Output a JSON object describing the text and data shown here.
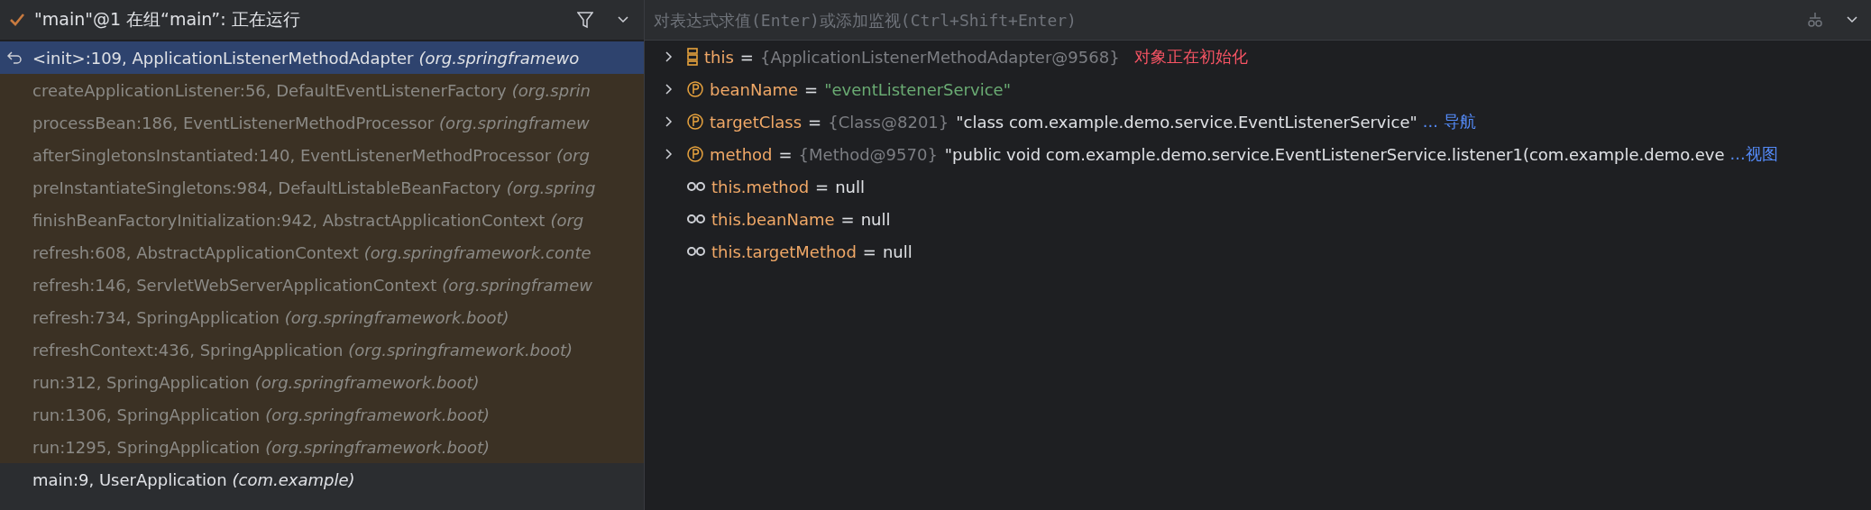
{
  "thread": {
    "check": true,
    "label": "\"main\"@1 在组“main”: 正在运行"
  },
  "frames": [
    {
      "method": "<init>:109, ApplicationListenerMethodAdapter",
      "package": "(org.springframewo",
      "selected": true,
      "library": false
    },
    {
      "method": "createApplicationListener:56, DefaultEventListenerFactory",
      "package": "(org.sprin",
      "selected": false,
      "library": true
    },
    {
      "method": "processBean:186, EventListenerMethodProcessor",
      "package": "(org.springframew",
      "selected": false,
      "library": true
    },
    {
      "method": "afterSingletonsInstantiated:140, EventListenerMethodProcessor",
      "package": "(org",
      "selected": false,
      "library": true
    },
    {
      "method": "preInstantiateSingletons:984, DefaultListableBeanFactory",
      "package": "(org.spring",
      "selected": false,
      "library": true
    },
    {
      "method": "finishBeanFactoryInitialization:942, AbstractApplicationContext",
      "package": "(org",
      "selected": false,
      "library": true
    },
    {
      "method": "refresh:608, AbstractApplicationContext",
      "package": "(org.springframework.conte",
      "selected": false,
      "library": true
    },
    {
      "method": "refresh:146, ServletWebServerApplicationContext",
      "package": "(org.springframew",
      "selected": false,
      "library": true
    },
    {
      "method": "refresh:734, SpringApplication",
      "package": "(org.springframework.boot)",
      "selected": false,
      "library": true
    },
    {
      "method": "refreshContext:436, SpringApplication",
      "package": "(org.springframework.boot)",
      "selected": false,
      "library": true
    },
    {
      "method": "run:312, SpringApplication",
      "package": "(org.springframework.boot)",
      "selected": false,
      "library": true
    },
    {
      "method": "run:1306, SpringApplication",
      "package": "(org.springframework.boot)",
      "selected": false,
      "library": true
    },
    {
      "method": "run:1295, SpringApplication",
      "package": "(org.springframework.boot)",
      "selected": false,
      "library": true
    },
    {
      "method": "main:9, UserApplication",
      "package": "(com.example)",
      "selected": false,
      "library": false
    }
  ],
  "evaluate": {
    "placeholder": "对表达式求值(Enter)或添加监视(Ctrl+Shift+Enter)"
  },
  "assign_sign": "=",
  "variables": [
    {
      "kind": "this",
      "expandable": true,
      "name": "this",
      "ref": "{ApplicationListenerMethodAdapter@9568}",
      "note": {
        "kind": "warning",
        "text": "对象正在初始化"
      }
    },
    {
      "kind": "field",
      "expandable": true,
      "name": "beanName",
      "value": "\"eventListenerService\"",
      "is_string": true
    },
    {
      "kind": "field",
      "expandable": true,
      "name": "targetClass",
      "ref": "{Class@8201}",
      "value": "\"class com.example.demo.service.EventListenerService\"",
      "is_string": false,
      "note": {
        "kind": "link",
        "text": "... 导航"
      }
    },
    {
      "kind": "field",
      "expandable": true,
      "name": "method",
      "ref": "{Method@9570}",
      "value": "\"public void com.example.demo.service.EventListenerService.listener1(com.example.demo.eve",
      "is_string": false,
      "note": {
        "kind": "link",
        "text": "...视图"
      }
    },
    {
      "kind": "watch",
      "expandable": false,
      "name": "this.method",
      "value": "null",
      "is_string": false
    },
    {
      "kind": "watch",
      "expandable": false,
      "name": "this.beanName",
      "value": "null",
      "is_string": false
    },
    {
      "kind": "watch",
      "expandable": false,
      "name": "this.targetMethod",
      "value": "null",
      "is_string": false
    }
  ]
}
